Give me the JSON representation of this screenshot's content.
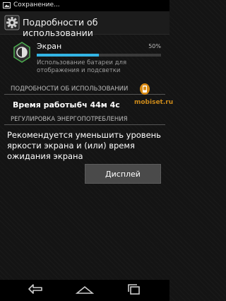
{
  "status_bar": {
    "text": "Сохранение...",
    "icon": "image-icon"
  },
  "action_bar": {
    "title": "Подробности об использовании",
    "icon": "gear-icon"
  },
  "app": {
    "name": "Экран",
    "percent": "50%",
    "usage_fraction": 0.5,
    "description": "Использование батареи для отображения и подсветки",
    "icon": "screen-brightness-icon",
    "bar_color": "#33b5e5"
  },
  "sections": {
    "usage_details": "ПОДРОБНОСТИ ОБ ИСПОЛЬЗОВАНИИ",
    "power_adjust": "РЕГУЛИРОВКА ЭНЕРГОПОТРЕБЛЕНИЯ"
  },
  "usage": {
    "label": "Время работы",
    "value": "6ч 44м 4с"
  },
  "recommendation": "Рекомендуется уменьшить уровень яркости экрана и (или) время ожидания экрана",
  "display_button": "Дисплей",
  "watermark": {
    "text": "mobiset.ru",
    "color": "#cc8a1a"
  },
  "nav": {
    "back": "back-icon",
    "home": "home-icon",
    "recent": "recent-apps-icon"
  }
}
